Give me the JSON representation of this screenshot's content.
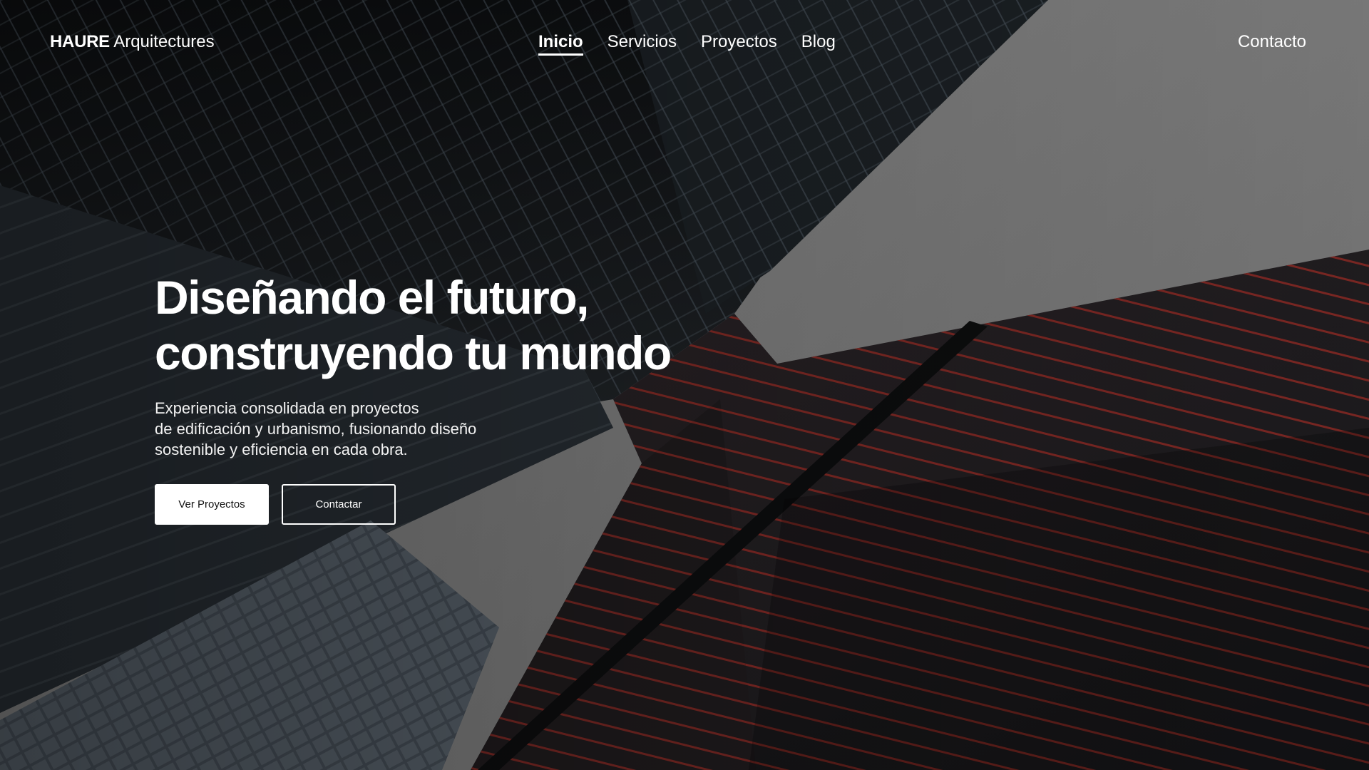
{
  "header": {
    "brand_strong": "HAURE",
    "brand_light": "Arquitectures",
    "nav": [
      {
        "label": "Inicio",
        "active": true
      },
      {
        "label": "Servicios",
        "active": false
      },
      {
        "label": "Proyectos",
        "active": false
      },
      {
        "label": "Blog",
        "active": false
      }
    ],
    "contact_label": "Contacto"
  },
  "hero": {
    "headline_lines": [
      "Diseñando el futuro,",
      "construyendo tu mundo"
    ],
    "subtitle_lines": [
      "Experiencia consolidada en proyectos",
      "de edificación y urbanismo, fusionando diseño",
      "sostenible y eficiencia en cada obra."
    ],
    "primary_button": "Ver Proyectos",
    "secondary_button": "Contactar"
  },
  "colors": {
    "text": "#ffffff",
    "accent_red": "#8f2a24",
    "sky": "#808080"
  }
}
